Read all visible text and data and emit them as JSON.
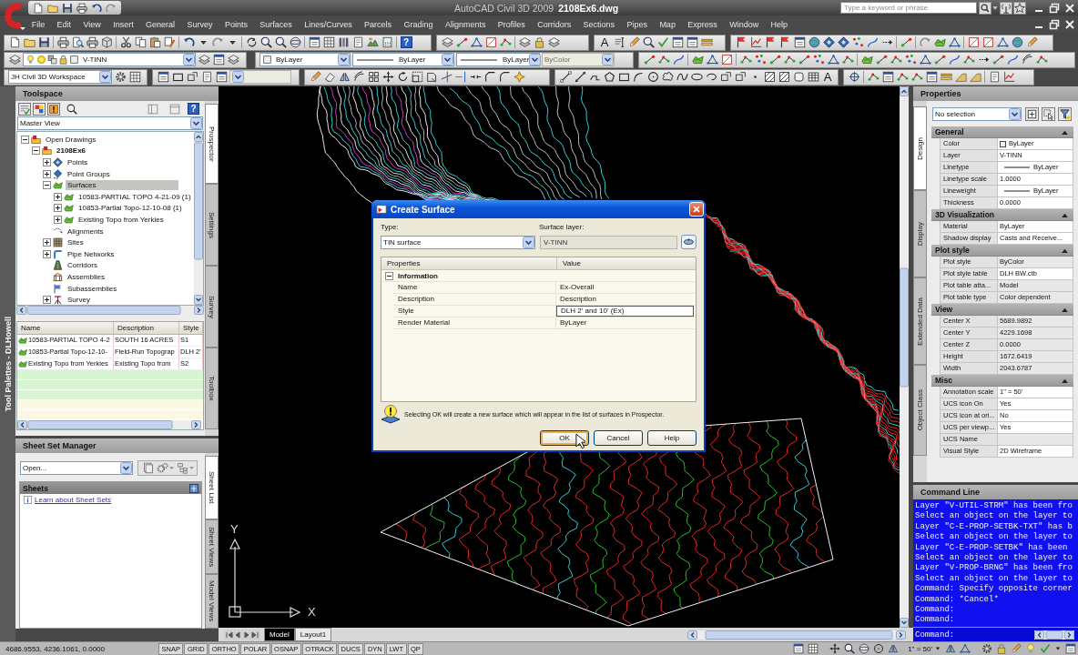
{
  "window": {
    "app_name": "AutoCAD Civil 3D 2009",
    "file_name": "2108Ex6.dwg",
    "search": {
      "placeholder": "Type a keyword or phrase"
    }
  },
  "menu": [
    "File",
    "Edit",
    "View",
    "Insert",
    "General",
    "Survey",
    "Points",
    "Surfaces",
    "Lines/Curves",
    "Parcels",
    "Grading",
    "Alignments",
    "Profiles",
    "Corridors",
    "Sections",
    "Pipes",
    "Map",
    "Express",
    "Window",
    "Help"
  ],
  "toolbars": {
    "help_glyph": "?",
    "text_glyphs": [
      "A",
      "A"
    ],
    "layer": "V-TINN",
    "color_control": "ByLayer",
    "linetype": "ByLayer",
    "lineweight": "ByLayer",
    "plot_style": {
      "value": "ByColor",
      "disabled": true
    },
    "workspace": "JH Civil 3D Workspace",
    "view_dropdown": {
      "disabled": true
    }
  },
  "tool_palettes": {
    "title": "Tool Palettes - DLHowell"
  },
  "toolspace": {
    "title": "Toolspace",
    "help_glyph": "?",
    "view": "Master View",
    "tree": [
      {
        "label": "Open Drawings",
        "kind": "drawings",
        "selected": false,
        "expanded": true,
        "children": [
          {
            "label": "2108Ex6",
            "kind": "drawing",
            "selected": false,
            "expanded": true,
            "children": [
              {
                "label": "Points",
                "kind": "points",
                "selected": false,
                "expanded": false
              },
              {
                "label": "Point Groups",
                "kind": "groups",
                "selected": false,
                "expanded": false
              },
              {
                "label": "Surfaces",
                "kind": "surfaces",
                "selected": true,
                "expanded": true,
                "children": [
                  {
                    "label": "10583-PARTIAL TOPO 4-21-09 (1)",
                    "kind": "surface",
                    "selected": false,
                    "expanded": false
                  },
                  {
                    "label": "10853-Partial Topo-12-10-08 (1)",
                    "kind": "surface",
                    "selected": false,
                    "expanded": false
                  },
                  {
                    "label": "Existing Topo from Yerkies",
                    "kind": "surface",
                    "selected": false,
                    "expanded": false
                  }
                ]
              },
              {
                "label": "Alignments",
                "kind": "alignments",
                "selected": false
              },
              {
                "label": "Sites",
                "kind": "sites",
                "selected": false,
                "expanded": false
              },
              {
                "label": "Pipe Networks",
                "kind": "pipes",
                "selected": false,
                "expanded": false
              },
              {
                "label": "Corridors",
                "kind": "corridors",
                "selected": false
              },
              {
                "label": "Assemblies",
                "kind": "assemblies",
                "selected": false
              },
              {
                "label": "Subassemblies",
                "kind": "subassemblies",
                "selected": false
              },
              {
                "label": "Survey",
                "kind": "survey",
                "selected": false,
                "expanded": false
              }
            ]
          }
        ]
      }
    ],
    "list": {
      "columns": [
        "Name",
        "Description",
        "Style"
      ],
      "rows": [
        [
          "10583-PARTIAL TOPO 4-2",
          "SOUTH 16 ACRES",
          "S1"
        ],
        [
          "10853-Partial Topo-12-10-",
          "Field-Run Topograp",
          "DLH 2'"
        ],
        [
          "Existing Topo from Yerkies",
          "Existing Topo from",
          "S2"
        ]
      ]
    },
    "tabs": [
      {
        "label": "Prospector",
        "selected": true
      },
      {
        "label": "Settings",
        "selected": false
      },
      {
        "label": "Survey",
        "selected": false
      },
      {
        "label": "Toolbox",
        "selected": false
      }
    ]
  },
  "sheet_set_manager": {
    "title": "Sheet Set Manager",
    "selector": "Open...",
    "panel_title": "Sheets",
    "link": "Learn about Sheet Sets",
    "tabs": [
      {
        "label": "Sheet List",
        "selected": true
      },
      {
        "label": "Sheet Views",
        "selected": false
      },
      {
        "label": "Model Views",
        "selected": false
      }
    ]
  },
  "drawing": {
    "ucs": {
      "y_label": "Y",
      "x_label": "X"
    },
    "layout_tabs": [
      {
        "label": "Model",
        "selected": true
      },
      {
        "label": "Layout1",
        "selected": false
      }
    ]
  },
  "dialog": {
    "title": "Create Surface",
    "type_label": "Type:",
    "type_value": "TIN surface",
    "layer_label": "Surface layer:",
    "layer_value": "V-TINN",
    "grid": {
      "columns": [
        "Properties",
        "Value"
      ],
      "group": {
        "title": "Information",
        "expanded": true
      },
      "rows": [
        {
          "name": "Name",
          "value": "Ex-Overall",
          "selected": false
        },
        {
          "name": "Description",
          "value": "Description",
          "selected": false
        },
        {
          "name": "Style",
          "value": "DLH 2' and 10' (Ex)",
          "selected": true
        },
        {
          "name": "Render Material",
          "value": "ByLayer",
          "selected": false
        }
      ]
    },
    "message": "Selecting OK will create a new surface which will appear in the list of surfaces in Prospector.",
    "buttons": [
      {
        "label": "OK",
        "default": true
      },
      {
        "label": "Cancel",
        "default": false
      },
      {
        "label": "Help",
        "default": false
      }
    ]
  },
  "properties": {
    "title": "Properties",
    "selection": "No selection",
    "tabs": [
      {
        "label": "Design",
        "selected": true
      },
      {
        "label": "Display",
        "selected": false
      },
      {
        "label": "Extended Data",
        "selected": false
      },
      {
        "label": "Object Class",
        "selected": false
      }
    ],
    "groups": [
      {
        "title": "General",
        "expanded": true,
        "rows": [
          {
            "name": "Color",
            "value": "ByLayer",
            "kind": "swatch",
            "read_only": false
          },
          {
            "name": "Layer",
            "value": "V-TINN",
            "kind": "text",
            "read_only": false
          },
          {
            "name": "Linetype",
            "value": "ByLayer",
            "kind": "line",
            "read_only": false
          },
          {
            "name": "Linetype scale",
            "value": "1.0000",
            "kind": "text",
            "read_only": false
          },
          {
            "name": "Lineweight",
            "value": "ByLayer",
            "kind": "line",
            "read_only": false
          },
          {
            "name": "Thickness",
            "value": "0.0000",
            "kind": "text",
            "read_only": false
          }
        ]
      },
      {
        "title": "3D Visualization",
        "expanded": true,
        "rows": [
          {
            "name": "Material",
            "value": "ByLayer",
            "kind": "text",
            "read_only": false
          },
          {
            "name": "Shadow display",
            "value": "Casts and Receive...",
            "kind": "text",
            "read_only": false
          }
        ]
      },
      {
        "title": "Plot style",
        "expanded": true,
        "rows": [
          {
            "name": "Plot style",
            "value": "ByColor",
            "kind": "text",
            "read_only": true
          },
          {
            "name": "Plot style table",
            "value": "DLH BW.ctb",
            "kind": "text",
            "read_only": false
          },
          {
            "name": "Plot table atta...",
            "value": "Model",
            "kind": "text",
            "read_only": true
          },
          {
            "name": "Plot table type",
            "value": "Color dependent",
            "kind": "text",
            "read_only": true
          }
        ]
      },
      {
        "title": "View",
        "expanded": true,
        "rows": [
          {
            "name": "Center X",
            "value": "5689.9892",
            "kind": "text",
            "read_only": true
          },
          {
            "name": "Center Y",
            "value": "4229.1698",
            "kind": "text",
            "read_only": true
          },
          {
            "name": "Center Z",
            "value": "0.0000",
            "kind": "text",
            "read_only": true
          },
          {
            "name": "Height",
            "value": "1672.6419",
            "kind": "text",
            "read_only": true
          },
          {
            "name": "Width",
            "value": "2043.6787",
            "kind": "text",
            "read_only": true
          }
        ]
      },
      {
        "title": "Misc",
        "expanded": true,
        "rows": [
          {
            "name": "Annotation scale",
            "value": "1\" = 50'",
            "kind": "text",
            "read_only": false
          },
          {
            "name": "UCS icon On",
            "value": "Yes",
            "kind": "text",
            "read_only": false
          },
          {
            "name": "UCS icon at ori...",
            "value": "No",
            "kind": "text",
            "read_only": false
          },
          {
            "name": "UCS per viewp...",
            "value": "Yes",
            "kind": "text",
            "read_only": false
          },
          {
            "name": "UCS Name",
            "kind": "text",
            "read_only": true
          },
          {
            "name": "Visual Style",
            "value": "2D Wireframe",
            "kind": "text",
            "read_only": false
          }
        ]
      }
    ]
  },
  "command_line": {
    "title": "Command Line",
    "history": [
      "Layer \"V-UTIL-STRM\" has been fro",
      "Select an object on the layer to",
      "Layer \"C-E-PROP-SETBK-TXT\" has b",
      "Select an object on the layer to",
      "Layer \"C-E-PROP-SETBK\" has been",
      "Select an object on the layer to",
      "Layer \"V-PROP-BRNG\" has been fro",
      "Select an object on the layer to",
      "Command: Specify opposite corner",
      "Command: *Cancel*",
      "Command:",
      "Command:"
    ],
    "prompt": "Command:"
  },
  "status_bar": {
    "coordinates": "4686.9553, 4236.1061, 0.0000",
    "toggles": [
      "SNAP",
      "GRID",
      "ORTHO",
      "POLAR",
      "OSNAP",
      "OTRACK",
      "DUCS",
      "DYN",
      "LWT",
      "QP"
    ],
    "annotation_scale": "1\" = 50'"
  }
}
